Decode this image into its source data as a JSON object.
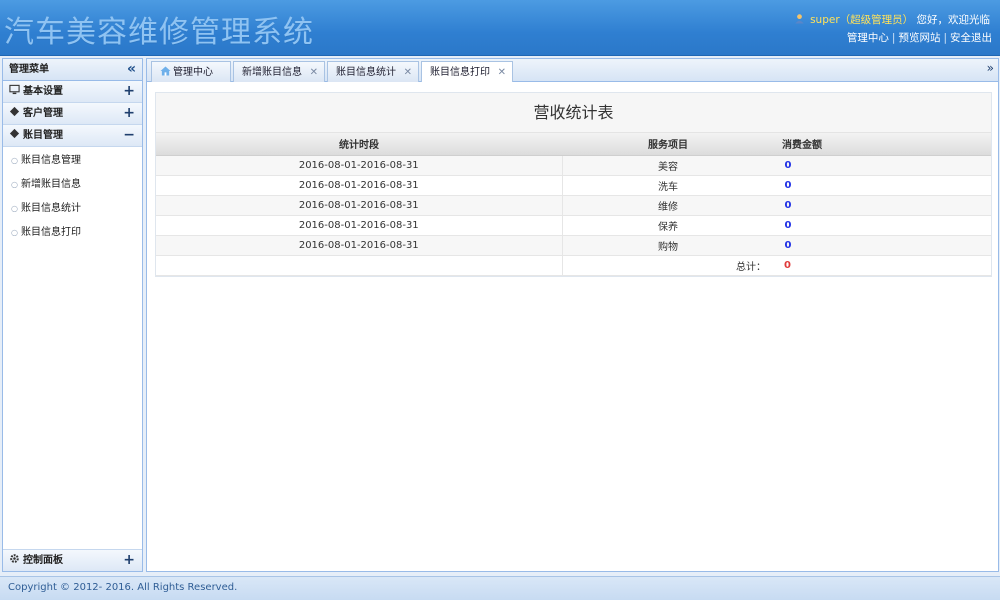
{
  "header": {
    "app_title": "汽车美容维修管理系统",
    "user_name": "super",
    "user_role": "（超级管理员）",
    "greeting": "您好，欢迎光临",
    "links": [
      "管理中心",
      "预览网站",
      "安全退出"
    ]
  },
  "sidebar": {
    "title": "管理菜单",
    "collapse_icon": "double-chevron-left-icon",
    "panels": [
      {
        "label": "基本设置",
        "icon": "monitor-icon",
        "toggle": "+"
      },
      {
        "label": "客户管理",
        "icon": "diamond-icon",
        "toggle": "+"
      },
      {
        "label": "账目管理",
        "icon": "diamond-icon",
        "toggle": "−"
      }
    ],
    "items": [
      "账目信息管理",
      "新增账目信息",
      "账目信息统计",
      "账目信息打印"
    ],
    "bottom_panel": {
      "label": "控制面板",
      "icon": "gear-icon",
      "toggle": "+"
    }
  },
  "tabs": [
    {
      "label": "管理中心",
      "icon": "home-icon",
      "closable": false
    },
    {
      "label": "新增账目信息",
      "closable": true
    },
    {
      "label": "账目信息统计",
      "closable": true
    },
    {
      "label": "账目信息打印",
      "closable": true,
      "active": true
    }
  ],
  "tab_scroll_icon": "double-chevron-down-icon",
  "report": {
    "title": "营收统计表",
    "columns": [
      "统计时段",
      "服务项目",
      "消费金额"
    ],
    "rows": [
      {
        "period": "2016-08-01-2016-08-31",
        "service": "美容",
        "amount": "0"
      },
      {
        "period": "2016-08-01-2016-08-31",
        "service": "洗车",
        "amount": "0"
      },
      {
        "period": "2016-08-01-2016-08-31",
        "service": "维修",
        "amount": "0"
      },
      {
        "period": "2016-08-01-2016-08-31",
        "service": "保养",
        "amount": "0"
      },
      {
        "period": "2016-08-01-2016-08-31",
        "service": "购物",
        "amount": "0"
      }
    ],
    "total_label": "总计：",
    "total_value": "0"
  },
  "footer": {
    "copyright": "Copyright © 2012- 2016. All Rights Reserved."
  },
  "colors": {
    "header_blue": "#2f7fd1",
    "amount_blue": "#1e2fe6",
    "total_red": "#e03a3a",
    "username_yellow": "#ffe25a"
  }
}
